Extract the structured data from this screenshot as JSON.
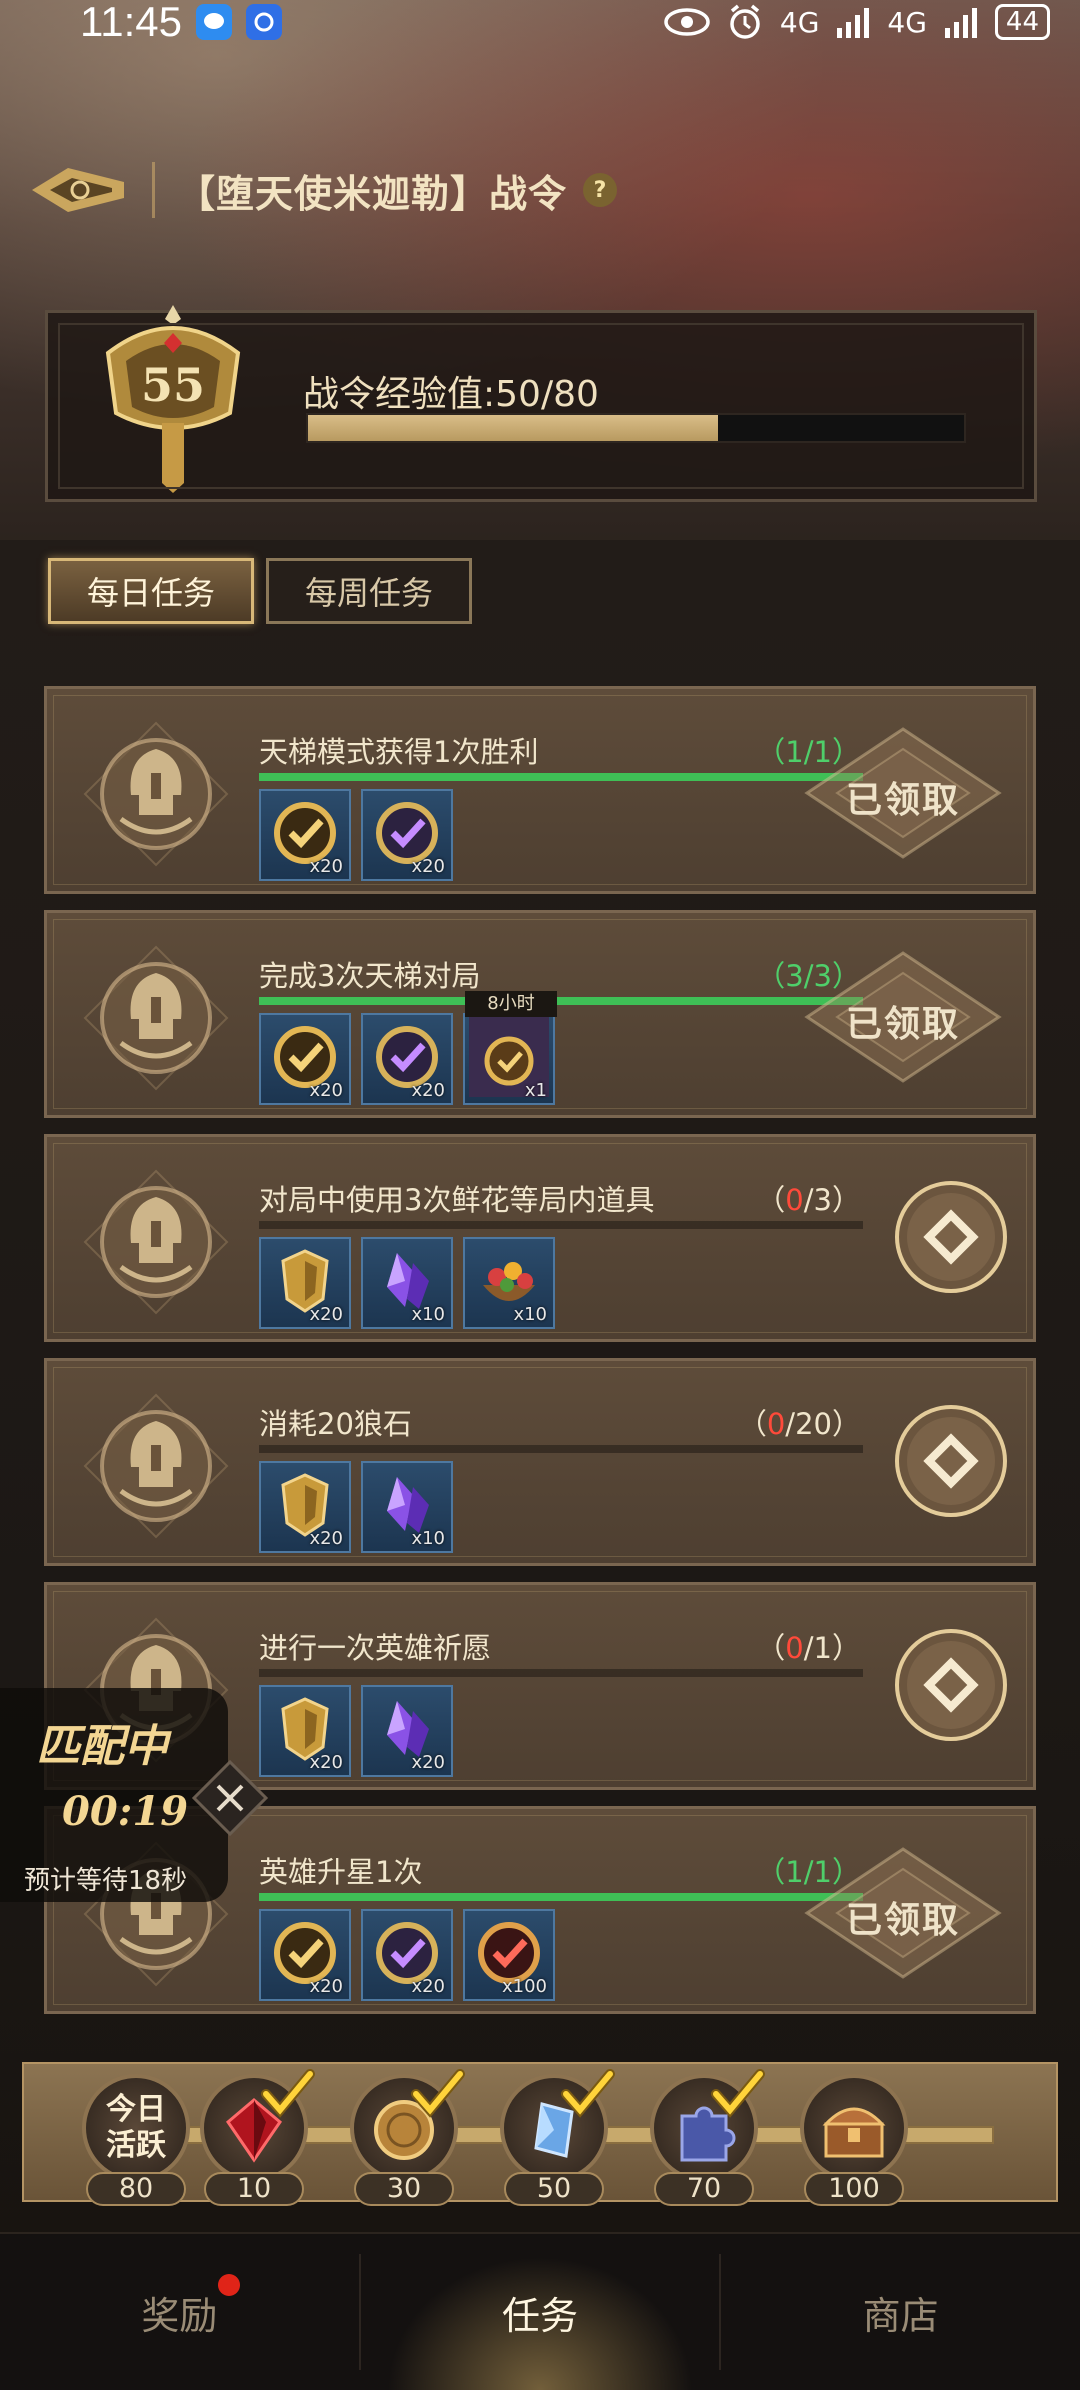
{
  "status_bar": {
    "time": "11:45",
    "network1": "4G",
    "network2": "4G",
    "battery": "44"
  },
  "header": {
    "title": "【堕天使米迦勒】战令",
    "help_icon": "?"
  },
  "exp": {
    "level": "55",
    "label": "战令经验值:50/80",
    "progress": 0.625
  },
  "tabs": [
    {
      "label": "每日任务",
      "active": true
    },
    {
      "label": "每周任务",
      "active": false
    }
  ],
  "tasks": [
    {
      "name": "天梯模式获得1次胜利",
      "done": "1",
      "total": "1",
      "progress_text_open": "(",
      "progress_text_close": ")",
      "status": "已领取",
      "complete": true,
      "rewards": [
        {
          "icon": "gold-check-token-icon",
          "qty": "x20"
        },
        {
          "icon": "purple-check-token-icon",
          "qty": "x20"
        }
      ]
    },
    {
      "name": "完成3次天梯对局",
      "done": "3",
      "total": "3",
      "status": "已领取",
      "complete": true,
      "rewards": [
        {
          "icon": "gold-check-token-icon",
          "qty": "x20"
        },
        {
          "icon": "purple-check-token-icon",
          "qty": "x20"
        },
        {
          "icon": "exp-card-icon",
          "qty": "x1",
          "tag": "8小时"
        }
      ]
    },
    {
      "name": "对局中使用3次鲜花等局内道具",
      "done": "0",
      "total": "3",
      "status": "go",
      "complete": false,
      "rewards": [
        {
          "icon": "gold-shield-icon",
          "qty": "x20"
        },
        {
          "icon": "purple-crystal-icon",
          "qty": "x10"
        },
        {
          "icon": "flower-basket-icon",
          "qty": "x10"
        }
      ]
    },
    {
      "name": "消耗20狼石",
      "done": "0",
      "total": "20",
      "status": "go",
      "complete": false,
      "rewards": [
        {
          "icon": "gold-shield-icon",
          "qty": "x20"
        },
        {
          "icon": "purple-crystal-icon",
          "qty": "x10"
        }
      ]
    },
    {
      "name": "进行一次英雄祈愿",
      "done": "0",
      "total": "1",
      "status": "go",
      "complete": false,
      "rewards": [
        {
          "icon": "gold-shield-icon",
          "qty": "x20"
        },
        {
          "icon": "purple-crystal-icon",
          "qty": "x20"
        }
      ]
    },
    {
      "name": "英雄升星1次",
      "done": "1",
      "total": "1",
      "status": "已领取",
      "complete": true,
      "rewards": [
        {
          "icon": "gold-check-token-icon",
          "qty": "x20"
        },
        {
          "icon": "purple-check-token-icon",
          "qty": "x20"
        },
        {
          "icon": "red-check-token-icon",
          "qty": "x100"
        }
      ]
    }
  ],
  "matching": {
    "title": "匹配中",
    "timer": "00:19",
    "wait": "预计等待18秒"
  },
  "activity": {
    "today_label_line1": "今日",
    "today_label_line2": "活跃",
    "today_value": "80",
    "milestones": [
      {
        "value": "10",
        "icon": "red-gem-icon",
        "claimed": true
      },
      {
        "value": "30",
        "icon": "gold-coin-icon",
        "claimed": true
      },
      {
        "value": "50",
        "icon": "blue-crystal-icon",
        "claimed": true
      },
      {
        "value": "70",
        "icon": "puzzle-piece-icon",
        "claimed": true
      },
      {
        "value": "100",
        "icon": "treasure-chest-icon",
        "claimed": false
      }
    ]
  },
  "bottom_nav": [
    {
      "label": "奖励",
      "active": false,
      "dot": true
    },
    {
      "label": "任务",
      "active": true,
      "dot": false
    },
    {
      "label": "商店",
      "active": false,
      "dot": false
    }
  ],
  "colors": {
    "accent_gold": "#d8b878",
    "progress_green": "#3fbf56",
    "progress_red": "#ff4a3a"
  }
}
